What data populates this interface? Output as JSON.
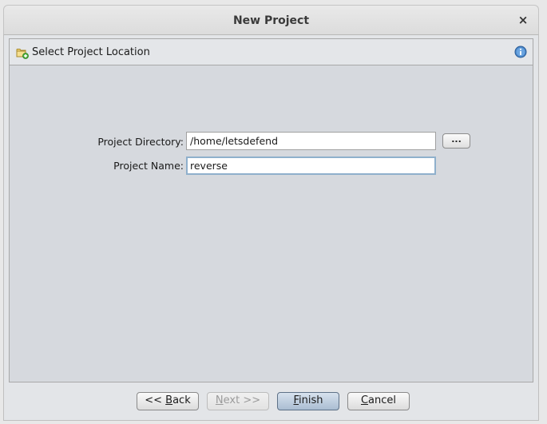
{
  "window": {
    "title": "New Project",
    "close_symbol": "×"
  },
  "step": {
    "label": "Select Project Location",
    "icon": "folder-new-icon",
    "help_icon": "info-icon"
  },
  "form": {
    "directory_label": "Project Directory:",
    "directory_value": "/home/letsdefend",
    "browse_label": "...",
    "name_label": "Project Name:",
    "name_value": "reverse"
  },
  "buttons": {
    "back": {
      "prefix": "<< ",
      "mnemonic": "B",
      "rest": "ack"
    },
    "next": {
      "mnemonic": "N",
      "rest": "ext >>"
    },
    "finish": {
      "mnemonic": "F",
      "rest": "inish"
    },
    "cancel": {
      "mnemonic": "C",
      "rest": "ancel"
    }
  },
  "colors": {
    "panel_background": "#d6d9de",
    "focus_border": "#8fb0cc",
    "default_button": "#aabdd2"
  }
}
